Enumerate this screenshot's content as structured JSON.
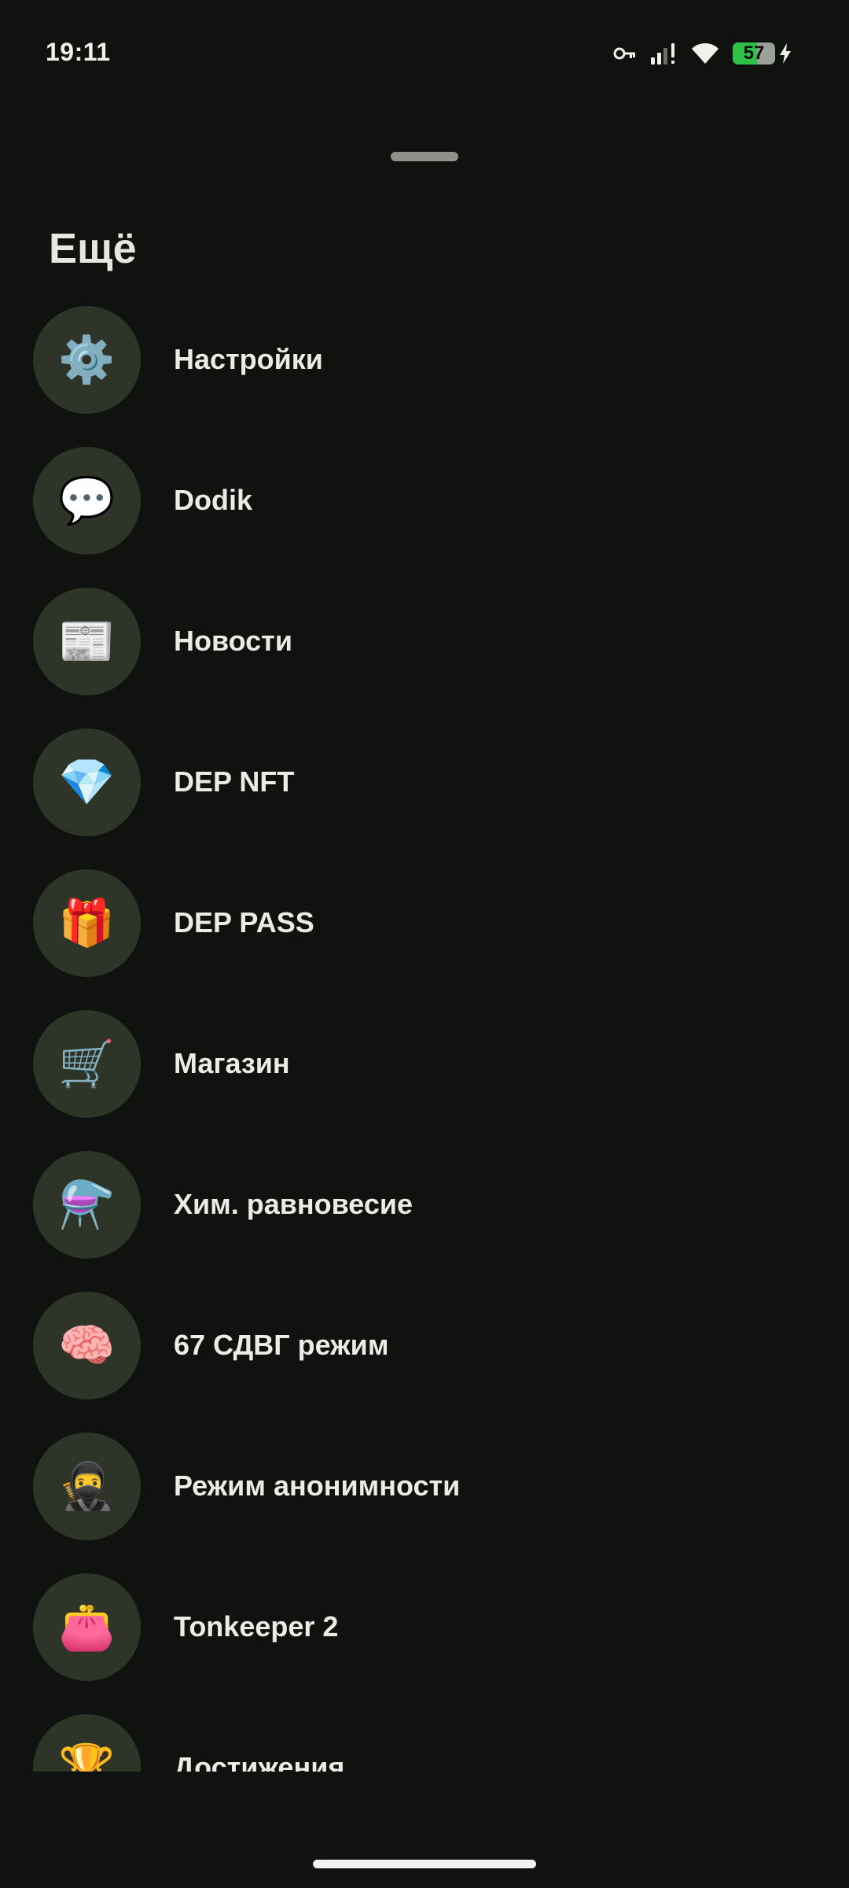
{
  "status_bar": {
    "time": "19:11",
    "battery_level": "57",
    "battery_fraction": 0.57,
    "icons": [
      "vpn-key-icon",
      "signal-icon",
      "wifi-icon",
      "battery-icon",
      "charging-icon"
    ]
  },
  "title": "Ещё",
  "menu": [
    {
      "label": "Настройки",
      "icon": "⚙️",
      "icon_name": "gear-icon"
    },
    {
      "label": "Dodik",
      "icon": "💬",
      "icon_name": "speech-bubble-icon"
    },
    {
      "label": "Новости",
      "icon": "📰",
      "icon_name": "newspaper-icon"
    },
    {
      "label": "DEP NFT",
      "icon": "💎",
      "icon_name": "gem-icon"
    },
    {
      "label": "DEP PASS",
      "icon": "🎁",
      "icon_name": "gift-icon"
    },
    {
      "label": "Магазин",
      "icon": "🛒",
      "icon_name": "shopping-cart-icon"
    },
    {
      "label": "Хим. равновесие",
      "icon": "⚗️",
      "icon_name": "alembic-icon"
    },
    {
      "label": "67 СДВГ режим",
      "icon": "🧠",
      "icon_name": "brain-icon"
    },
    {
      "label": "Режим анонимности",
      "icon": "🥷",
      "icon_name": "ninja-icon"
    },
    {
      "label": "Tonkeeper 2",
      "icon": "👛",
      "icon_name": "purse-icon"
    },
    {
      "label": "Достижения",
      "icon": "🏆",
      "icon_name": "trophy-icon"
    }
  ],
  "colors": {
    "background": "#101210",
    "icon_circle": "#2e3428",
    "text": "#ececE6",
    "battery_fill": "#2fc24a"
  }
}
